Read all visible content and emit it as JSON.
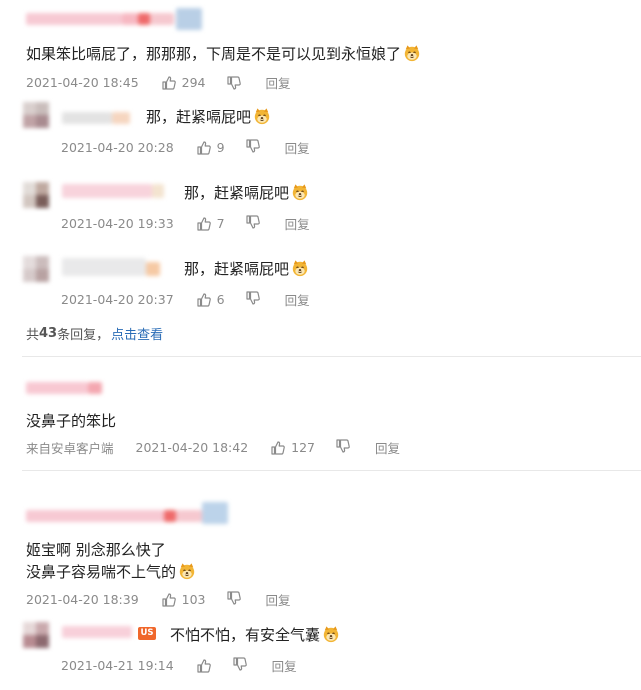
{
  "comments": [
    {
      "text": "如果笨比嗝屁了，那那那，下周是不是可以见到永恒娘了",
      "time": "2021-04-20 18:45",
      "likes": "294",
      "reply_label": "回复",
      "replies": [
        {
          "text": "那，赶紧嗝屁吧",
          "time": "2021-04-20 20:28",
          "likes": "9",
          "reply_label": "回复"
        },
        {
          "text": "那，赶紧嗝屁吧",
          "time": "2021-04-20 19:33",
          "likes": "7",
          "reply_label": "回复"
        },
        {
          "text": "那，赶紧嗝屁吧",
          "time": "2021-04-20 20:37",
          "likes": "6",
          "reply_label": "回复"
        }
      ],
      "reply_summary_prefix": "共",
      "reply_summary_count": "43",
      "reply_summary_suffix": "条回复，",
      "view_link": "点击查看"
    },
    {
      "text": "没鼻子的笨比",
      "source": "来自安卓客户端",
      "time": "2021-04-20 18:42",
      "likes": "127",
      "reply_label": "回复"
    },
    {
      "text_line1": "姬宝啊 别念那么快了",
      "text_line2": "没鼻子容易喘不上气的",
      "time": "2021-04-20 18:39",
      "likes": "103",
      "reply_label": "回复",
      "replies": [
        {
          "badge": "US",
          "text": "不怕不怕，有安全气囊",
          "time": "2021-04-21 19:14",
          "reply_label": "回复"
        }
      ]
    }
  ],
  "colors": {
    "link": "#2a6cb6",
    "meta": "#8a8a8a",
    "badge": "#f0672b",
    "name_pink": "#f7c6d0"
  }
}
